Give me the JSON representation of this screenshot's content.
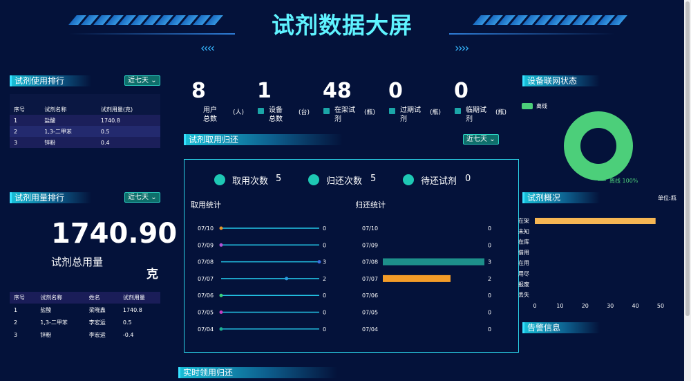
{
  "header": {
    "title": "试剂数据大屏",
    "left_arrows": "‹‹‹‹",
    "right_arrows": "››››"
  },
  "left": {
    "usage_rank": {
      "title": "试剂使用排行",
      "range": "近七天",
      "columns": [
        "序号",
        "试剂名称",
        "试剂用量(克)"
      ],
      "rows": [
        [
          "1",
          "盐酸",
          "1740.8"
        ],
        [
          "2",
          "1,3-二甲苯",
          "0.5"
        ],
        [
          "3",
          "锌粉",
          "0.4"
        ]
      ]
    },
    "amount_rank": {
      "title": "试剂用量排行",
      "range": "近七天",
      "total": "1740.90",
      "total_label": "试剂总用量",
      "unit": "克",
      "columns": [
        "序号",
        "试剂名称",
        "姓名",
        "试剂用量"
      ],
      "rows": [
        [
          "1",
          "盐酸",
          "梁晓鑫",
          "1740.8"
        ],
        [
          "2",
          "1,3-二甲苯",
          "李宏运",
          "0.5"
        ],
        [
          "3",
          "锌粉",
          "李宏运",
          "-0.4"
        ]
      ]
    }
  },
  "center": {
    "stats": [
      {
        "value": "8",
        "label": "用户总数",
        "unit": "(人)",
        "icon": "user-icon"
      },
      {
        "value": "1",
        "label": "设备总数",
        "unit": "(台)",
        "icon": "device-icon"
      },
      {
        "value": "48",
        "label": "在架试剂",
        "unit": "(瓶)",
        "icon": "shelf-icon"
      },
      {
        "value": "0",
        "label": "过期试剂",
        "unit": "(瓶)",
        "icon": "expired-icon"
      },
      {
        "value": "0",
        "label": "临期试剂",
        "unit": "(瓶)",
        "icon": "near-expiry-icon"
      }
    ],
    "take_return": {
      "title": "试剂取用归还",
      "range": "近七天",
      "counters": [
        {
          "label": "取用次数",
          "value": "5"
        },
        {
          "label": "归还次数",
          "value": "5"
        },
        {
          "label": "待还试剂",
          "value": "0"
        }
      ],
      "take_title": "取用统计",
      "return_title": "归还统计"
    },
    "realtime_title": "实时领用归还"
  },
  "right": {
    "network": {
      "title": "设备联网状态",
      "legend": "离线",
      "pie_label": "离线 100%",
      "color": "#4ccf7a"
    },
    "overview": {
      "title": "试剂概况",
      "unit": "单位:瓶",
      "categories": [
        "在架",
        "未知",
        "在库",
        "借用",
        "在用",
        "用尽",
        "报废",
        "丢失"
      ],
      "values": [
        48,
        0,
        0,
        0,
        0,
        0,
        0,
        0
      ],
      "xticks": [
        "0",
        "10",
        "20",
        "30",
        "40",
        "50"
      ]
    },
    "alarm_title": "告警信息"
  },
  "chart_data": [
    {
      "type": "line",
      "title": "取用统计",
      "categories": [
        "07/10",
        "07/09",
        "07/08",
        "07/07",
        "07/06",
        "07/05",
        "07/04"
      ],
      "values": [
        0,
        0,
        3,
        2,
        0,
        0,
        0
      ],
      "colors": [
        "#e8952a",
        "#b552d6",
        "#3a6fe0",
        "#2a9be0",
        "#3ad07a",
        "#c43cc0",
        "#1db08f"
      ]
    },
    {
      "type": "bar",
      "title": "归还统计",
      "categories": [
        "07/10",
        "07/09",
        "07/08",
        "07/07",
        "07/06",
        "07/05",
        "07/04"
      ],
      "values": [
        0,
        0,
        3,
        2,
        0,
        0,
        0
      ],
      "colors": [
        "#1d8f8a",
        "#1d8f8a",
        "#1d8f8a",
        "#f39c28",
        "#1d8f8a",
        "#1d8f8a",
        "#1d8f8a"
      ]
    }
  ]
}
